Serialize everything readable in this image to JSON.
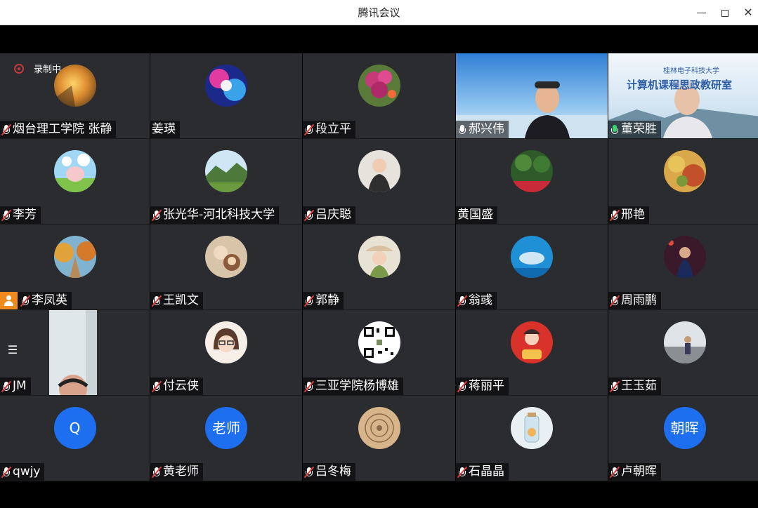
{
  "window": {
    "title": "腾讯会议",
    "minimize": "—",
    "close": "✕"
  },
  "recording": {
    "label": "录制中"
  },
  "colors": {
    "tile_bg": "#2b2c2f",
    "avatar_blue": "#1e6ff0",
    "mic_muted": "#e23b3b",
    "rec_red": "#c2393c"
  },
  "participants": [
    {
      "name": "烟台理工学院 张静",
      "mic": "muted",
      "avatar": "sunset-photo"
    },
    {
      "name": "姜瑛",
      "mic": "none",
      "avatar": "anime-photo"
    },
    {
      "name": "段立平",
      "mic": "muted",
      "avatar": "flower-photo"
    },
    {
      "name": "郝兴伟",
      "mic": "on",
      "avatar": "video-feed"
    },
    {
      "name": "董荣胜",
      "mic": "speaking",
      "avatar": "video-feed"
    },
    {
      "name": "李芳",
      "mic": "muted",
      "avatar": "pig-cartoon"
    },
    {
      "name": "张光华-河北科技大学",
      "mic": "muted",
      "avatar": "mountain-photo"
    },
    {
      "name": "吕庆聪",
      "mic": "muted",
      "avatar": "child-photo"
    },
    {
      "name": "黄国盛",
      "mic": "none",
      "avatar": "garden-photo"
    },
    {
      "name": "邢艳",
      "mic": "muted",
      "avatar": "autumn-photo"
    },
    {
      "name": "李凤英",
      "mic": "muted",
      "avatar": "autumn-road-photo",
      "host": true
    },
    {
      "name": "王凯文",
      "mic": "muted",
      "avatar": "cartoon-photo"
    },
    {
      "name": "郭静",
      "mic": "muted",
      "avatar": "hat-photo"
    },
    {
      "name": "翁彧",
      "mic": "muted",
      "avatar": "dolphin-photo"
    },
    {
      "name": "周雨鹏",
      "mic": "muted",
      "avatar": "stage-photo"
    },
    {
      "name": "JM",
      "mic": "muted",
      "avatar": "video-feed"
    },
    {
      "name": "付云侠",
      "mic": "muted",
      "avatar": "glasses-cartoon"
    },
    {
      "name": "三亚学院杨博雄",
      "mic": "muted",
      "avatar": "qr-code"
    },
    {
      "name": "蒋丽平",
      "mic": "muted",
      "avatar": "baby-photo"
    },
    {
      "name": "王玉茹",
      "mic": "muted",
      "avatar": "beach-photo"
    },
    {
      "name": "qwjy",
      "mic": "muted",
      "avatar_text": "Q"
    },
    {
      "name": "黄老师",
      "mic": "muted",
      "avatar_text": "老师"
    },
    {
      "name": "吕冬梅",
      "mic": "muted",
      "avatar": "pattern-photo"
    },
    {
      "name": "石晶晶",
      "mic": "muted",
      "avatar": "jar-photo"
    },
    {
      "name": "卢朝晖",
      "mic": "muted",
      "avatar_text": "朝晖"
    }
  ],
  "video_banner": {
    "school": "桂林电子科技大学",
    "title": "计算机课程思政教研室"
  }
}
